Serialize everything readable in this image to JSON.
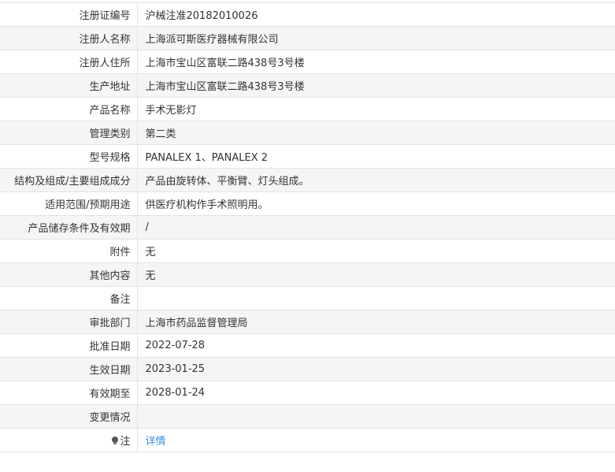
{
  "rows": [
    {
      "label": "注册证编号",
      "value": "沪械注准20182010026"
    },
    {
      "label": "注册人名称",
      "value": "上海派可斯医疗器械有限公司"
    },
    {
      "label": "注册人住所",
      "value": "上海市宝山区富联二路438号3号楼"
    },
    {
      "label": "生产地址",
      "value": "上海市宝山区富联二路438号3号楼"
    },
    {
      "label": "产品名称",
      "value": "手术无影灯"
    },
    {
      "label": "管理类别",
      "value": "第二类"
    },
    {
      "label": "型号规格",
      "value": "PANALEX 1、PANALEX 2"
    },
    {
      "label": "结构及组成/主要组成成分",
      "value": "产品由旋转体、平衡臂、灯头组成。"
    },
    {
      "label": "适用范围/预期用途",
      "value": "供医疗机构作手术照明用。"
    },
    {
      "label": "产品储存条件及有效期",
      "value": "/"
    },
    {
      "label": "附件",
      "value": "无"
    },
    {
      "label": "其他内容",
      "value": "无"
    },
    {
      "label": "备注",
      "value": ""
    },
    {
      "label": "审批部门",
      "value": "上海市药品监督管理局"
    },
    {
      "label": "批准日期",
      "value": "2022-07-28"
    },
    {
      "label": "生效日期",
      "value": "2023-01-25"
    },
    {
      "label": "有效期至",
      "value": "2028-01-24"
    },
    {
      "label": "变更情况",
      "value": ""
    }
  ],
  "note_row": {
    "label": "注",
    "icon": "bulb-icon",
    "link_text": "详情"
  },
  "colors": {
    "link": "#3a8ee6",
    "stripe": "#f5f5f5",
    "border": "#e3e3e3"
  }
}
